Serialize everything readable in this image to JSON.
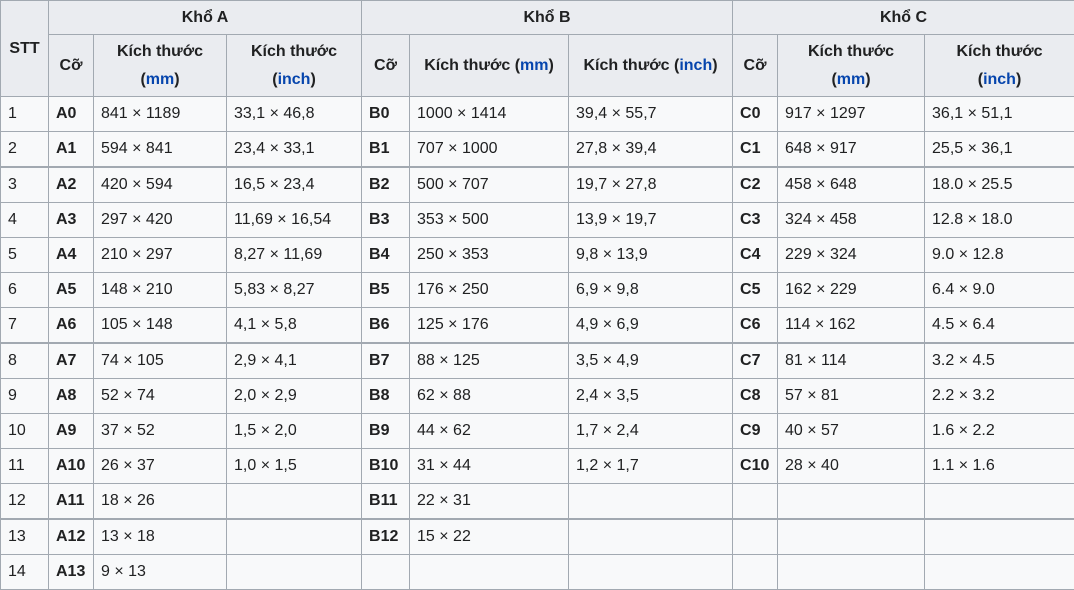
{
  "header": {
    "stt": "STT",
    "groups": [
      "Khổ A",
      "Khổ B",
      "Khổ C"
    ],
    "size_label": "Cỡ",
    "dim_label": "Kích thước",
    "mm": "mm",
    "inch": "inch"
  },
  "rows": [
    {
      "stt": "1",
      "a": [
        "A0",
        "841 × 1189",
        "33,1 × 46,8"
      ],
      "b": [
        "B0",
        "1000 × 1414",
        "39,4 × 55,7"
      ],
      "c": [
        "C0",
        "917 × 1297",
        "36,1 × 51,1"
      ]
    },
    {
      "stt": "2",
      "a": [
        "A1",
        "594 × 841",
        "23,4 × 33,1"
      ],
      "b": [
        "B1",
        "707 × 1000",
        "27,8 × 39,4"
      ],
      "c": [
        "C1",
        "648 × 917",
        "25,5 × 36,1"
      ]
    },
    {
      "stt": "3",
      "a": [
        "A2",
        "420 × 594",
        "16,5 × 23,4"
      ],
      "b": [
        "B2",
        "500 × 707",
        "19,7 × 27,8"
      ],
      "c": [
        "C2",
        "458 × 648",
        "18.0 × 25.5"
      ]
    },
    {
      "stt": "4",
      "a": [
        "A3",
        "297 × 420",
        "11,69 × 16,54"
      ],
      "b": [
        "B3",
        "353 × 500",
        "13,9 × 19,7"
      ],
      "c": [
        "C3",
        "324 × 458",
        "12.8 × 18.0"
      ]
    },
    {
      "stt": "5",
      "a": [
        "A4",
        "210 × 297",
        "8,27 × 11,69"
      ],
      "b": [
        "B4",
        "250 × 353",
        "9,8 × 13,9"
      ],
      "c": [
        "C4",
        "229 × 324",
        "9.0 × 12.8"
      ]
    },
    {
      "stt": "6",
      "a": [
        "A5",
        "148 × 210",
        "5,83 × 8,27"
      ],
      "b": [
        "B5",
        "176 × 250",
        "6,9 × 9,8"
      ],
      "c": [
        "C5",
        "162 × 229",
        "6.4 × 9.0"
      ]
    },
    {
      "stt": "7",
      "a": [
        "A6",
        "105 × 148",
        "4,1 × 5,8"
      ],
      "b": [
        "B6",
        "125 × 176",
        "4,9 × 6,9"
      ],
      "c": [
        "C6",
        "114 × 162",
        "4.5 × 6.4"
      ]
    },
    {
      "stt": "8",
      "a": [
        "A7",
        "74 × 105",
        "2,9 × 4,1"
      ],
      "b": [
        "B7",
        "88 × 125",
        "3,5 × 4,9"
      ],
      "c": [
        "C7",
        "81 × 114",
        "3.2 × 4.5"
      ]
    },
    {
      "stt": "9",
      "a": [
        "A8",
        "52 × 74",
        "2,0 × 2,9"
      ],
      "b": [
        "B8",
        "62 × 88",
        "2,4 × 3,5"
      ],
      "c": [
        "C8",
        "57 × 81",
        "2.2 × 3.2"
      ]
    },
    {
      "stt": "10",
      "a": [
        "A9",
        "37 × 52",
        "1,5 × 2,0"
      ],
      "b": [
        "B9",
        "44 × 62",
        "1,7 × 2,4"
      ],
      "c": [
        "C9",
        "40 × 57",
        "1.6 × 2.2"
      ]
    },
    {
      "stt": "11",
      "a": [
        "A10",
        "26 × 37",
        "1,0 × 1,5"
      ],
      "b": [
        "B10",
        "31 × 44",
        "1,2 × 1,7"
      ],
      "c": [
        "C10",
        "28 × 40",
        "1.1 × 1.6"
      ]
    },
    {
      "stt": "12",
      "a": [
        "A11",
        "18 × 26",
        ""
      ],
      "b": [
        "B11",
        "22 × 31",
        ""
      ],
      "c": [
        "",
        "",
        ""
      ]
    },
    {
      "stt": "13",
      "a": [
        "A12",
        "13 × 18",
        ""
      ],
      "b": [
        "B12",
        "15 × 22",
        ""
      ],
      "c": [
        "",
        "",
        ""
      ]
    },
    {
      "stt": "14",
      "a": [
        "A13",
        "9 × 13",
        ""
      ],
      "b": [
        "",
        "",
        ""
      ],
      "c": [
        "",
        "",
        ""
      ]
    }
  ]
}
